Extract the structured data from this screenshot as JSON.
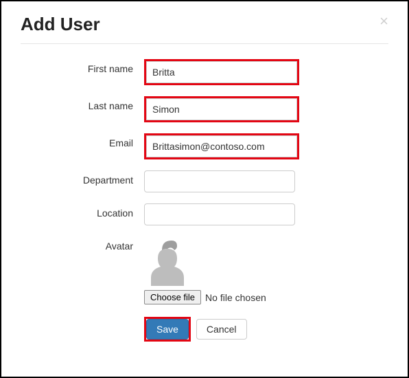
{
  "header": {
    "title": "Add User"
  },
  "form": {
    "first_name": {
      "label": "First name",
      "value": "Britta"
    },
    "last_name": {
      "label": "Last name",
      "value": "Simon"
    },
    "email": {
      "label": "Email",
      "value": "Brittasimon@contoso.com"
    },
    "department": {
      "label": "Department",
      "value": ""
    },
    "location": {
      "label": "Location",
      "value": ""
    },
    "avatar": {
      "label": "Avatar",
      "choose_label": "Choose file",
      "file_status": "No file chosen"
    }
  },
  "actions": {
    "save_label": "Save",
    "cancel_label": "Cancel"
  }
}
